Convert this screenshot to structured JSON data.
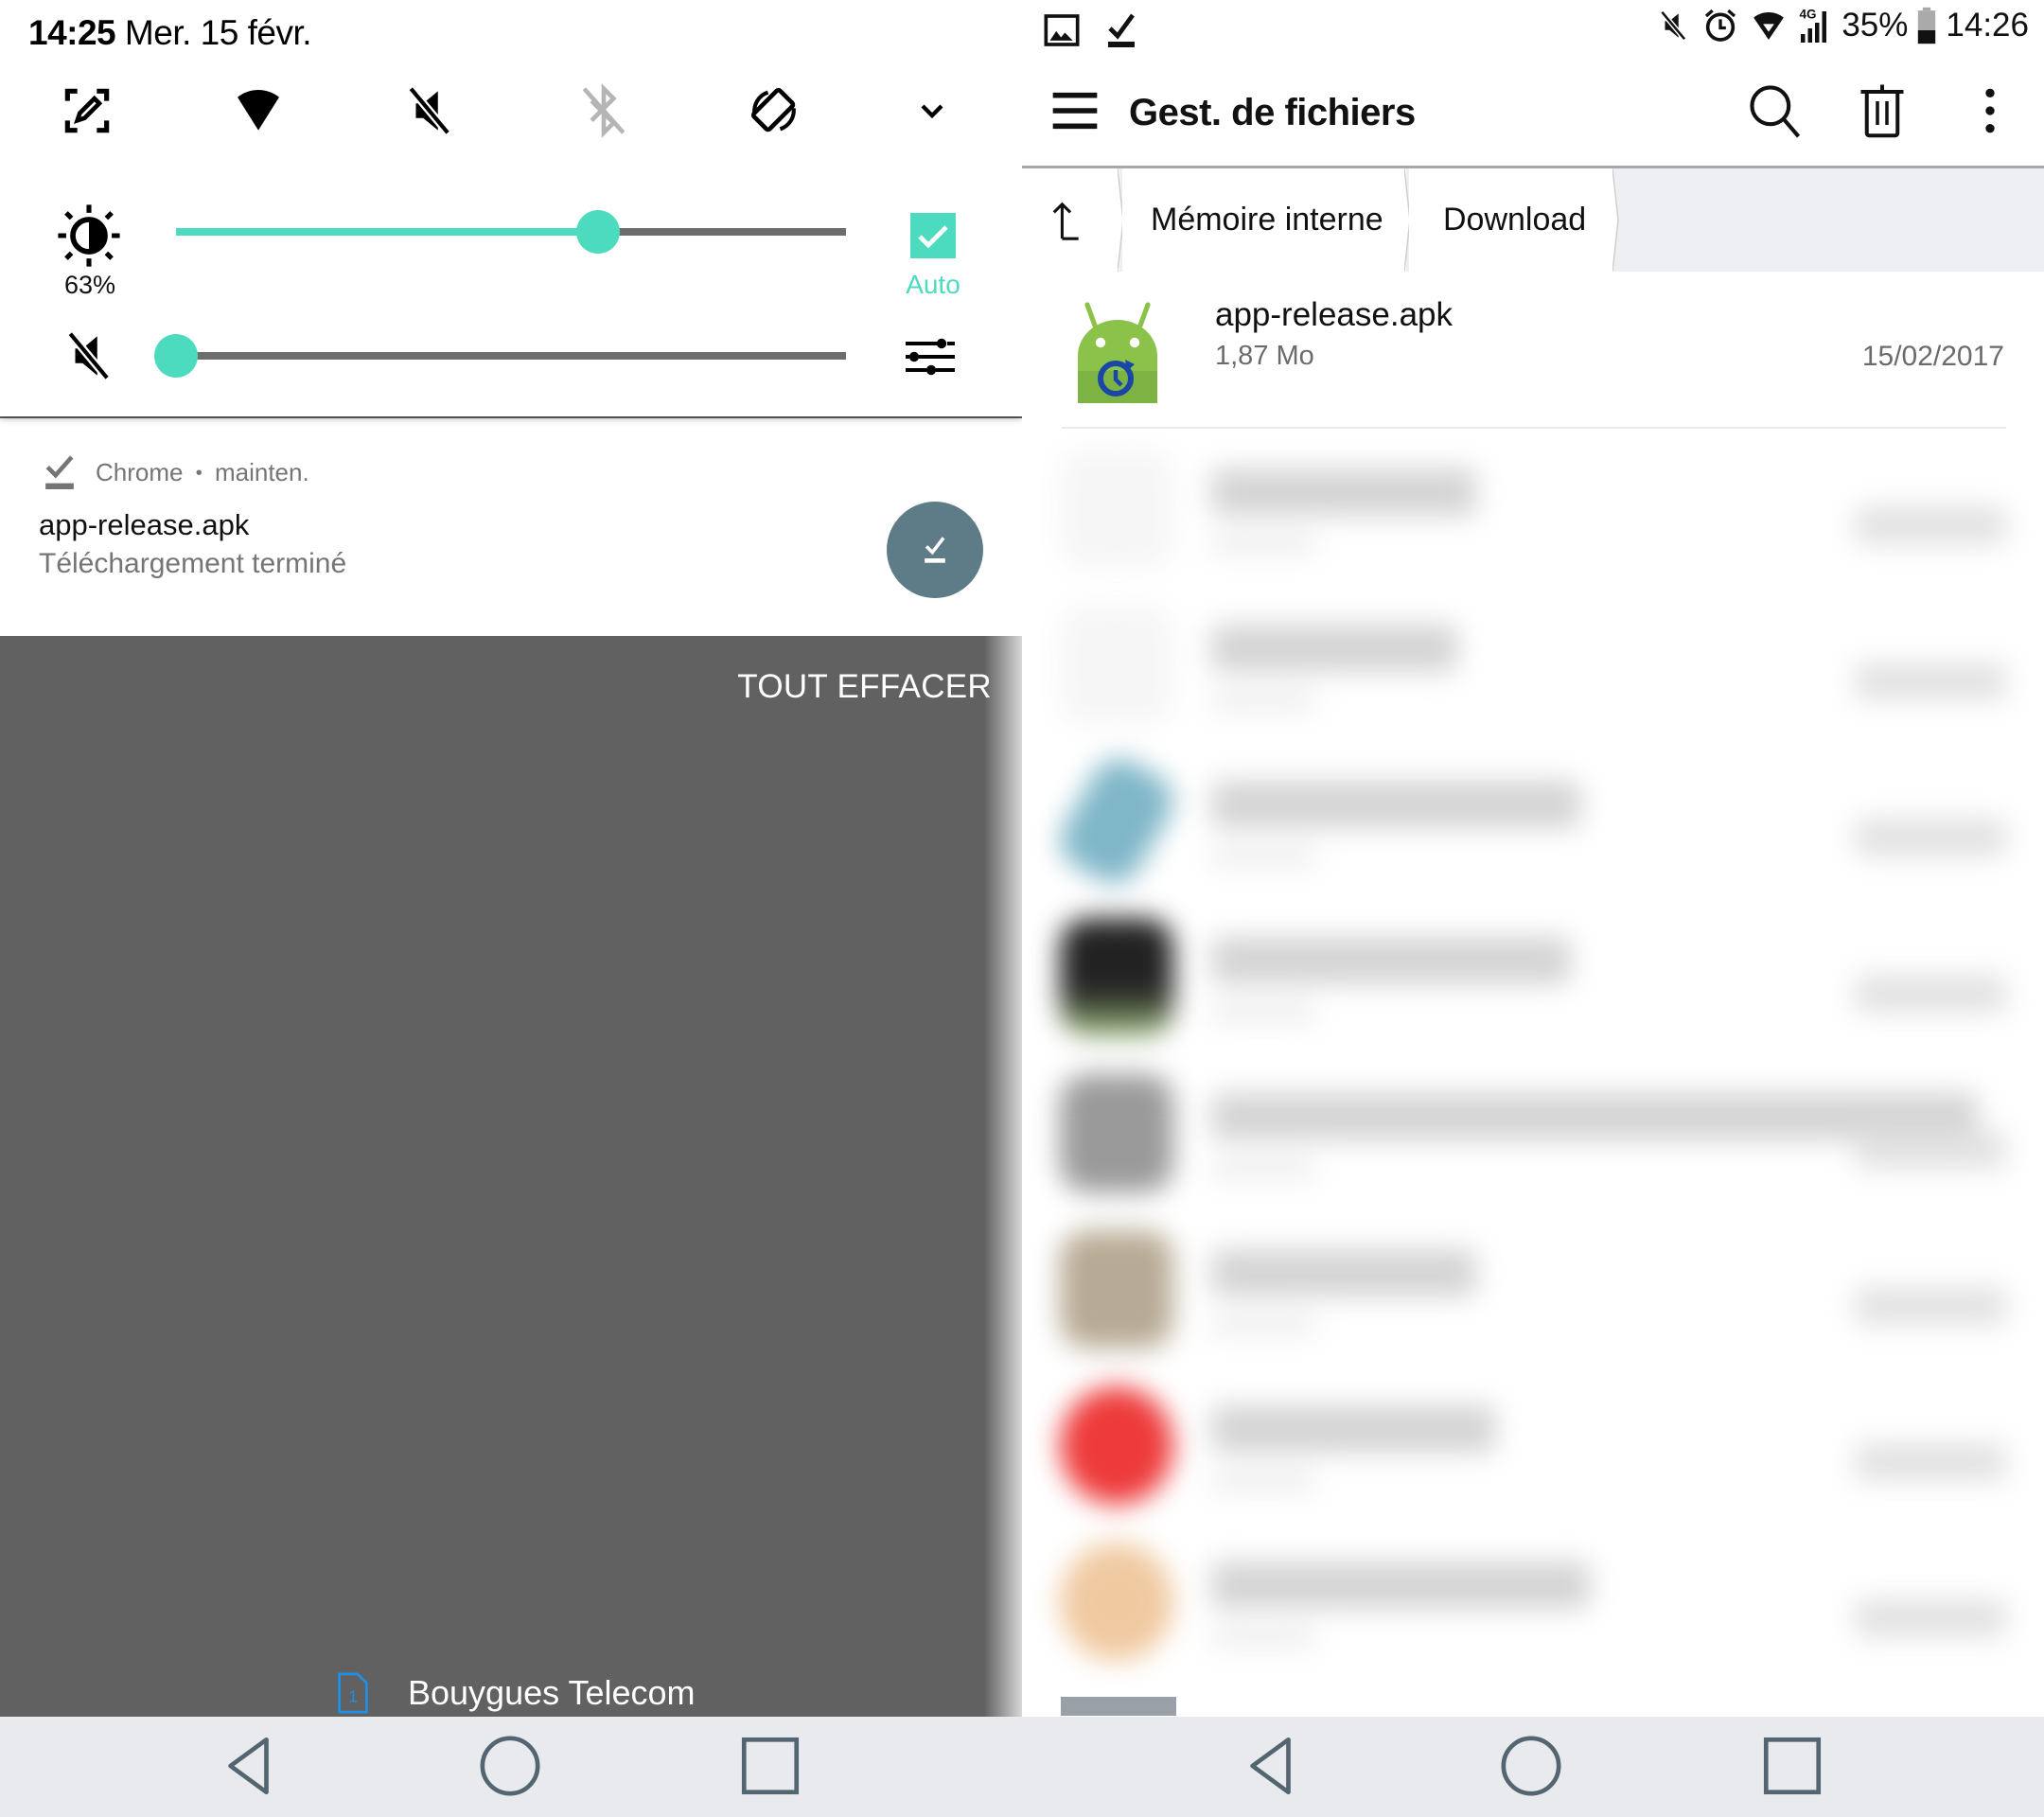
{
  "left_panel": {
    "header": {
      "time": "14:25",
      "date": "Mer. 15 févr."
    },
    "quick_settings": [
      {
        "icon": "screen-capture-icon",
        "state": "on"
      },
      {
        "icon": "wifi-icon",
        "state": "on"
      },
      {
        "icon": "sound-off-icon",
        "state": "on"
      },
      {
        "icon": "bluetooth-off-icon",
        "state": "off"
      },
      {
        "icon": "auto-rotate-icon",
        "state": "on"
      },
      {
        "icon": "chevron-down-icon",
        "state": "expand"
      }
    ],
    "brightness": {
      "value_percent": 63,
      "label": "63%",
      "auto_checked": true,
      "auto_label": "Auto"
    },
    "volume": {
      "value_percent": 0,
      "muted": true
    },
    "colors": {
      "accent": "#4cdbbf",
      "track": "#6d6d6d",
      "shade": "#616161",
      "notif_action": "#5e7b88"
    },
    "notification": {
      "app": "Chrome",
      "separator": "•",
      "time": "mainten.",
      "title": "app-release.apk",
      "subtitle": "Téléchargement terminé"
    },
    "clear_all_label": "TOUT EFFACER",
    "carrier": {
      "sim_slot": "1",
      "name": "Bouygues Telecom"
    }
  },
  "right_panel": {
    "status_bar": {
      "left_icons": [
        "gallery-icon",
        "download-done-icon"
      ],
      "right_icons": [
        "mute-icon",
        "alarm-icon",
        "wifi-icon",
        "signal-4g-icon",
        "battery-icon"
      ],
      "network": "4G",
      "battery": "35%",
      "time": "14:26"
    },
    "toolbar": {
      "title": "Gest. de fichiers"
    },
    "breadcrumb": [
      {
        "label": "Mémoire interne"
      },
      {
        "label": "Download"
      }
    ],
    "files": [
      {
        "name": "app-release.apk",
        "size": "1,87 Mo",
        "date": "15/02/2017"
      }
    ]
  },
  "navbar": {
    "buttons": [
      "back",
      "home",
      "recents"
    ]
  }
}
